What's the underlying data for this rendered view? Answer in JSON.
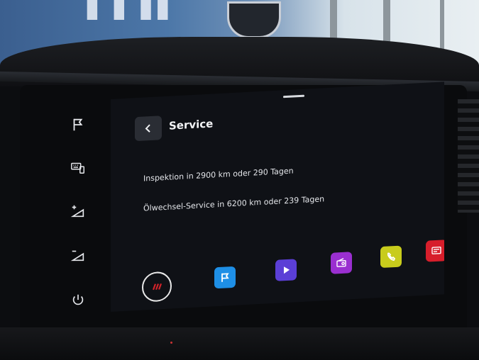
{
  "screen": {
    "title": "Service",
    "info_lines": [
      "Inspektion in 2900 km oder 290 Tagen",
      "Ölwechsel-Service in 6200 km oder 239 Tagen"
    ]
  },
  "hardkeys": [
    {
      "name": "flag-icon"
    },
    {
      "name": "keyboard-phone-icon"
    },
    {
      "name": "volume-up-icon"
    },
    {
      "name": "volume-down-icon"
    },
    {
      "name": "power-icon"
    }
  ],
  "dock": [
    {
      "name": "brand-home-icon",
      "color": "#d2232a"
    },
    {
      "name": "navigation-flag-icon",
      "color": "#1e8fe6"
    },
    {
      "name": "media-play-icon",
      "color": "#5b3fd6"
    },
    {
      "name": "radio-icon",
      "color": "#9a2fd0"
    },
    {
      "name": "phone-icon",
      "color": "#c8cc1c"
    },
    {
      "name": "car-info-icon",
      "color": "#d71e2b"
    }
  ]
}
